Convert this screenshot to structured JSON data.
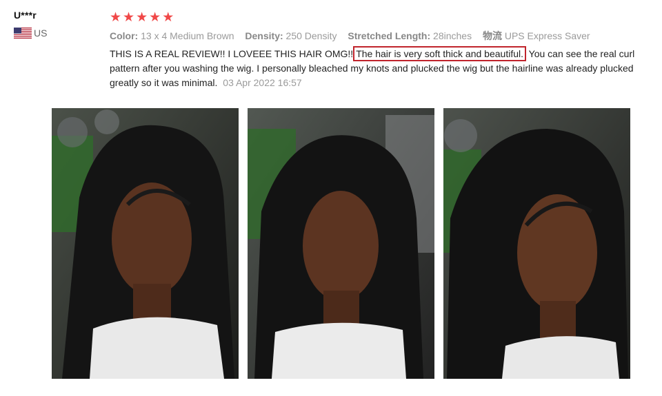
{
  "reviewer": {
    "name": "U***r",
    "country": "US",
    "flag_icon": "us-flag-icon"
  },
  "review": {
    "rating": 5,
    "rating_color": "#f04848",
    "attributes": [
      {
        "label": "Color:",
        "value": "13 x 4 Medium Brown"
      },
      {
        "label": "Density:",
        "value": "250 Density"
      },
      {
        "label": "Stretched Length:",
        "value": "28inches"
      },
      {
        "label": "物流",
        "value": "UPS Express Saver"
      }
    ],
    "text_before": "THIS IS A REAL REVIEW!! I LOVEEE THIS HAIR OMG!!",
    "text_highlight": "The hair is very soft thick and beautiful.",
    "text_after": "You can see the real curl pattern after you washing the wig. I personally bleached my knots and plucked the wig but the hairline was already plucked greatly so it was minimal.",
    "date": "03 Apr 2022 16:57",
    "highlight_color": "#c0232b"
  },
  "photos": [
    {
      "name": "review-photo-1"
    },
    {
      "name": "review-photo-2"
    },
    {
      "name": "review-photo-3"
    }
  ]
}
